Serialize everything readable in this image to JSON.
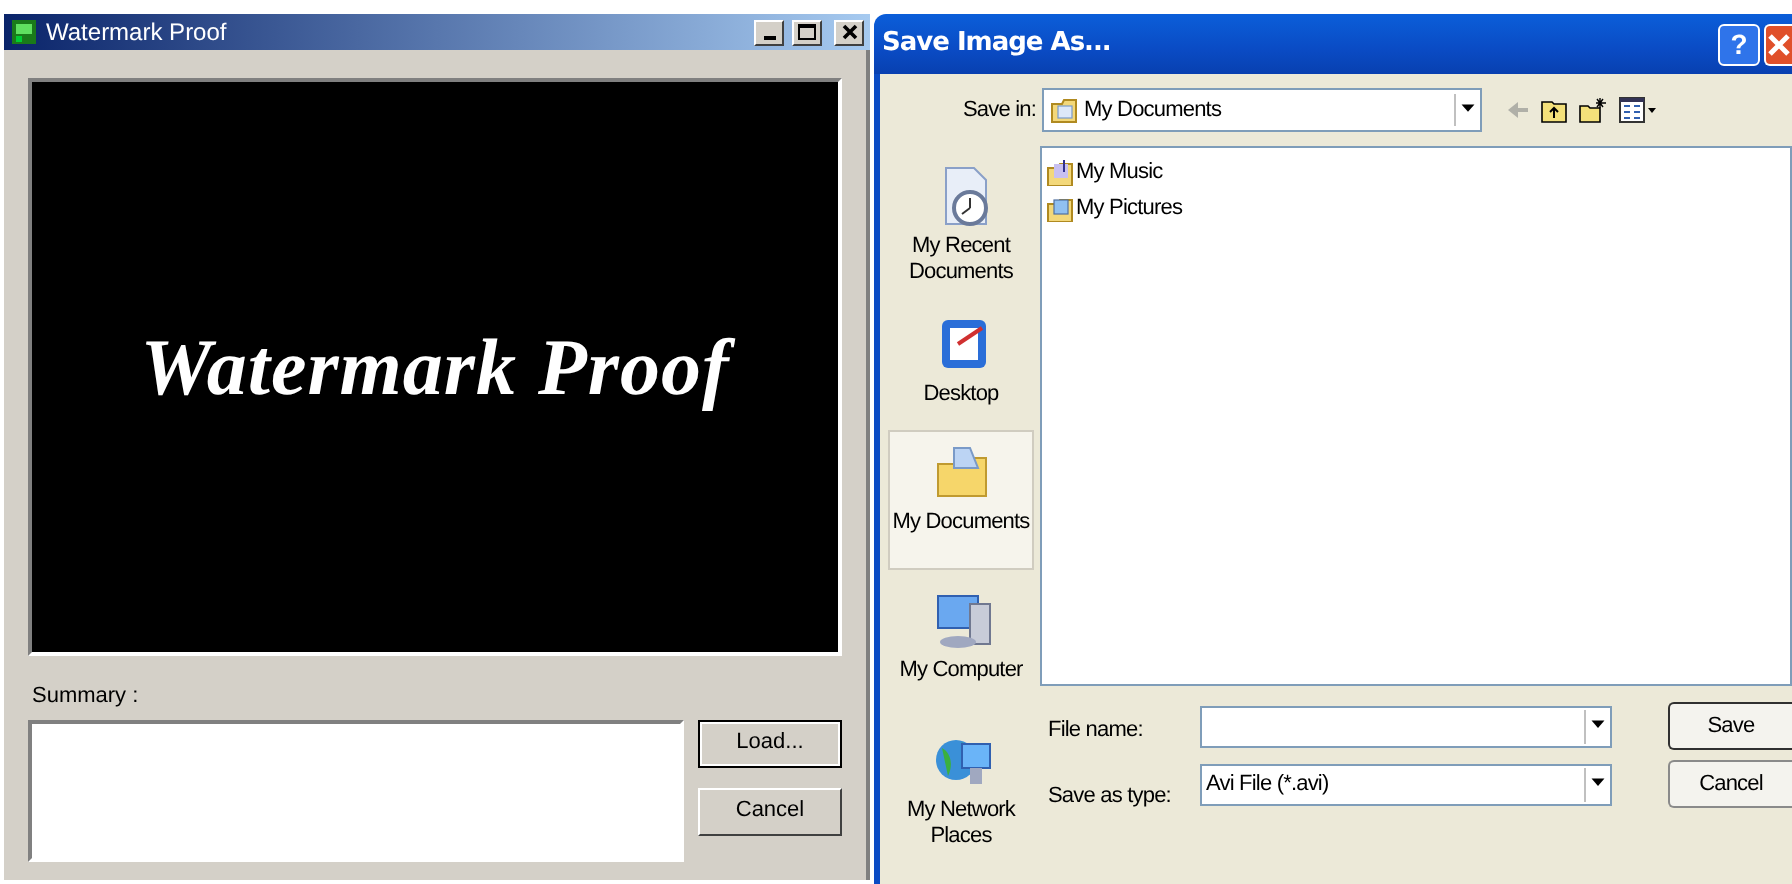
{
  "app_window": {
    "title": "Watermark Proof",
    "preview_text": "Watermark Proof",
    "summary_label": "Summary :",
    "buttons": [
      "Load...",
      "Cancel"
    ]
  },
  "dialog": {
    "title": "Save Image As...",
    "help_button": "?",
    "save_in_label": "Save in:",
    "save_in_value": "My Documents",
    "places": [
      {
        "kind": "recent",
        "label": "My Recent Documents",
        "selected": false
      },
      {
        "kind": "desktop",
        "label": "Desktop",
        "selected": false
      },
      {
        "kind": "documents",
        "label": "My Documents",
        "selected": true
      },
      {
        "kind": "computer",
        "label": "My Computer",
        "selected": false
      },
      {
        "kind": "network",
        "label": "My Network Places",
        "selected": false
      }
    ],
    "files": [
      {
        "kind": "music",
        "name": "My Music"
      },
      {
        "kind": "pictures",
        "name": "My Pictures"
      }
    ],
    "file_name_label": "File name:",
    "save_as_type_label": "Save as type:",
    "save_as_type_value": "Avi File (*.avi)",
    "buttons": [
      "Save",
      "Cancel"
    ]
  }
}
